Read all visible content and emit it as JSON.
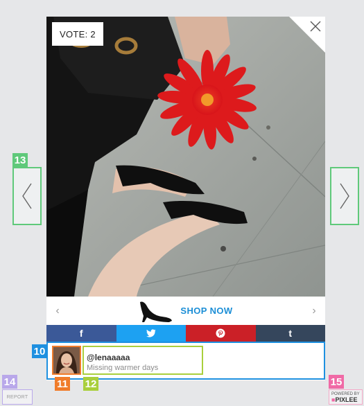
{
  "lightbox": {
    "vote_label": "VOTE: 2",
    "shop_now_label": "SHOP NOW",
    "shop_prev_glyph": "‹",
    "shop_next_glyph": "›"
  },
  "share": [
    {
      "network": "facebook",
      "glyph": "f",
      "color": "#3b5998"
    },
    {
      "network": "twitter",
      "glyph": "🐦",
      "color": "#1da1f2"
    },
    {
      "network": "pinterest",
      "glyph": "℗",
      "color": "#cb2027"
    },
    {
      "network": "tumblr",
      "glyph": "t",
      "color": "#35465c"
    }
  ],
  "user": {
    "handle": "@lenaaaaa",
    "caption": "Missing warmer days"
  },
  "footer": {
    "report_label": "REPORT",
    "powered_by": "POWERED BY",
    "brand": "PIXLEE"
  },
  "annotations": {
    "label_10": "10",
    "label_11": "11",
    "label_12": "12",
    "label_13": "13",
    "label_14": "14",
    "label_15": "15"
  },
  "colors": {
    "blue_annotation": "#1e90e0",
    "orange_annotation": "#f07c2a",
    "lime_annotation": "#a9cf3c",
    "green_annotation": "#5fc97a",
    "purple_annotation": "#b9a8ea",
    "pink_annotation": "#f06aa6",
    "accent": "#1b8ed6"
  }
}
